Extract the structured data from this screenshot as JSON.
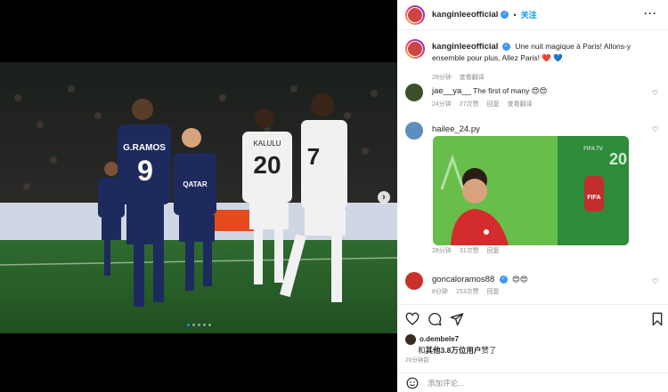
{
  "post": {
    "username": "kanginleeofficial",
    "follow_label": "关注",
    "more_label": "···"
  },
  "caption": {
    "username": "kanginleeofficial",
    "text": "Une nuit magique à Paris! Allons-y ensemble pour plus, Allez Paris! ❤️ 💙",
    "time": "29分钟",
    "translate": "查看翻译"
  },
  "comments": [
    {
      "username": "jae__ya__",
      "text": "The first of many 😍😍",
      "time": "24分钟",
      "likes": "27次赞",
      "reply": "回复",
      "translate": "查看翻译"
    },
    {
      "username": "hailee_24.py",
      "text": "",
      "time": "28分钟",
      "likes": "31次赞",
      "reply": "回复"
    },
    {
      "username": "goncaloramos88",
      "text": "😍😍",
      "time": "8分钟",
      "likes": "153次赞",
      "reply": "回复"
    }
  ],
  "photo": {
    "players": [
      {
        "name": "G.RAMOS",
        "number": "9"
      },
      {
        "name": "KALULU",
        "number": "20"
      },
      {
        "number": "7"
      }
    ],
    "sponsor": "QATAR",
    "carousel_total": 5,
    "carousel_active": 0
  },
  "gif": {
    "badge": "FIFA",
    "channel": "FIFA TV",
    "number": "20"
  },
  "likes": {
    "liker": "o.dembele7",
    "prefix": "和",
    "count_text": "其他3.8万位用户",
    "suffix": "赞了"
  },
  "timestamp": "29分钟前",
  "add_comment": {
    "placeholder": "添加评论..."
  },
  "colors": {
    "psg_navy": "#1d2a5e",
    "accent": "#0095f6",
    "pitch": "#2f6b2f"
  },
  "icons": [
    "heart-icon",
    "comment-icon",
    "share-icon",
    "bookmark-icon",
    "emoji-icon",
    "more-icon",
    "next-arrow-icon"
  ]
}
